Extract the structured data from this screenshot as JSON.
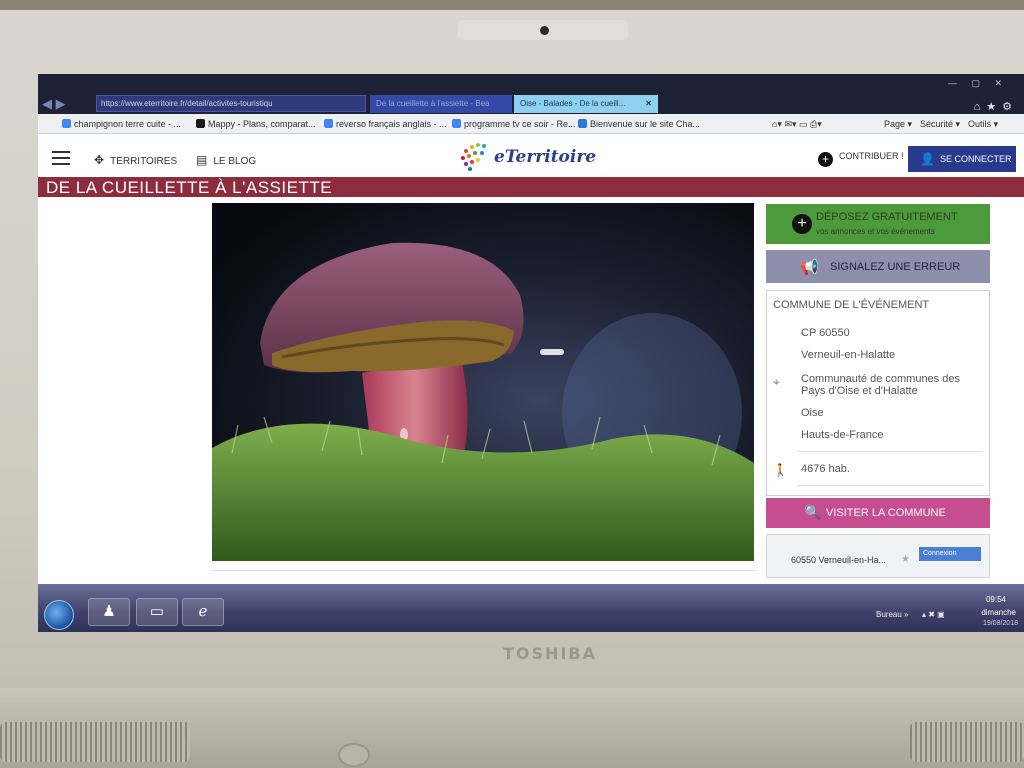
{
  "device": {
    "brand": "TOSHIBA"
  },
  "browser": {
    "address": "https://www.eterritoire.fr/detail/activites-touristiqu",
    "tabs": [
      {
        "label": "De la cueillette à l'assiette - Bea"
      },
      {
        "label": "Oise - Balades - De la cueill..."
      }
    ],
    "favorites": [
      {
        "label": "champignon terre cuite - ...",
        "icon": "google-icon",
        "color": "#4285f4"
      },
      {
        "label": "Mappy - Plans, comparat...",
        "icon": "mappy-icon",
        "color": "#1a1a1a"
      },
      {
        "label": "reverso français anglais - ...",
        "icon": "google-icon",
        "color": "#4285f4"
      },
      {
        "label": "programme tv ce soir - Re...",
        "icon": "google-icon",
        "color": "#4285f4"
      },
      {
        "label": "Bienvenue sur le site Cha...",
        "icon": "ie-icon",
        "color": "#2b7bd6"
      }
    ],
    "menus": [
      "Page ▾",
      "Sécurité ▾",
      "Outils ▾"
    ]
  },
  "site": {
    "nav": [
      {
        "label": "TERRITOIRES",
        "icon": "binoculars-icon"
      },
      {
        "label": "LE BLOG",
        "icon": "blog-icon"
      }
    ],
    "logo_text": "eTerritoire",
    "contribute_label": "CONTRIBUER !",
    "login_label": "SE CONNECTER",
    "page_title": "DE LA CUEILLETTE À L'ASSIETTE"
  },
  "sidebar": {
    "deposit": {
      "title": "DÉPOSEZ GRATUITEMENT",
      "subtitle": "vos annonces et vos événements"
    },
    "report_error_label": "SIGNALEZ UNE ERREUR",
    "commune": {
      "heading": "COMMUNE DE L'ÉVÉNEMENT",
      "postal": "CP 60550",
      "name": "Verneuil-en-Halatte",
      "community": "Communauté de communes des Pays d'Oise et d'Halatte",
      "department": "Oise",
      "region": "Hauts-de-France",
      "population": "4676 hab."
    },
    "visit_label": "VISITER LA COMMUNE",
    "map": {
      "place_label": "60550 Verneuil-en-Ha...",
      "connect_label": "Connexion"
    }
  },
  "taskbar": {
    "desktop_label": "Bureau",
    "time": "09:54",
    "day": "dimanche",
    "date": "19/08/2018"
  },
  "colors": {
    "title_bar": "#8c2c3c",
    "deposit_green": "#4c9a3b",
    "report_gray": "#8e8fab",
    "visit_pink": "#c64d8f",
    "login_blue": "#283a8e"
  }
}
